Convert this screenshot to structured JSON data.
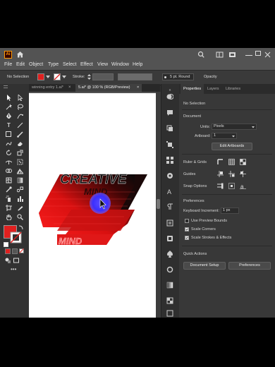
{
  "menu": [
    "File",
    "Edit",
    "Object",
    "Type",
    "Select",
    "Effect",
    "View",
    "Window",
    "Help"
  ],
  "control": {
    "selection": "No Selection",
    "fill_color": "#e0201f",
    "stroke_label": "Stroke:",
    "brush_label": "5 pt. Round",
    "opacity_label": "Opacity"
  },
  "doc_tabs": [
    {
      "label": "winning entry 1.ai*"
    },
    {
      "label": "5.ai* @ 100 % (RGB/Preview)"
    }
  ],
  "artwork": {
    "text_top": "CREATIVE",
    "text_mid": "MIND",
    "text_bottom": "MIND"
  },
  "panel": {
    "tabs": [
      "Properties",
      "Layers",
      "Libraries"
    ],
    "no_selection": "No Selection",
    "document": {
      "header": "Document",
      "units_label": "Units:",
      "units_value": "Pixels",
      "artboard_label": "Artboard:",
      "artboard_value": "1",
      "edit_artboards": "Edit Artboards"
    },
    "rulers_grids": "Ruler & Grids",
    "guides": "Guides",
    "snap_options": "Snap Options",
    "preferences": {
      "header": "Preferences",
      "keyboard_increment_label": "Keyboard Increment:",
      "keyboard_increment_value": "1 px",
      "use_preview_bounds": "Use Preview Bounds",
      "scale_corners": "Scale Corners",
      "scale_strokes": "Scale Strokes & Effects"
    },
    "quick_actions": {
      "header": "Quick Actions",
      "document_setup": "Document Setup",
      "preferences": "Preferences"
    }
  },
  "colors": {
    "accent_red": "#e0201f",
    "cursor_blue": "#3a2fff"
  }
}
